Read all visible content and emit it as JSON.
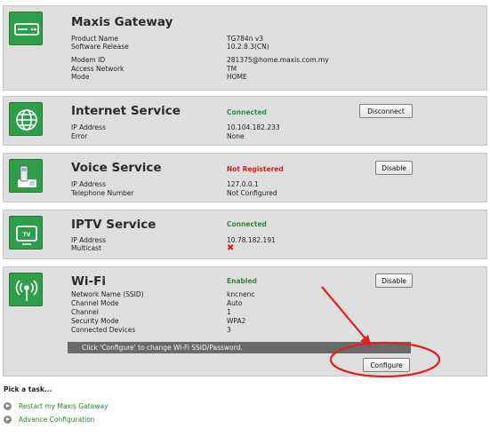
{
  "gateway": {
    "title": "Maxis Gateway",
    "rows": [
      {
        "label": "Product Name",
        "value": "TG784n v3"
      },
      {
        "label": "Software Release",
        "value": "10.2.8.3(CN)"
      },
      {
        "label": "Modem ID",
        "value": "281375@home.maxis.com.my"
      },
      {
        "label": "Access Network",
        "value": "TM"
      },
      {
        "label": "Mode",
        "value": "HOME"
      }
    ]
  },
  "internet": {
    "title": "Internet Service",
    "status": "Connected",
    "button": "Disconnect",
    "rows": [
      {
        "label": "IP Address",
        "value": "10.104.182.233"
      },
      {
        "label": "Error",
        "value": "None"
      }
    ]
  },
  "voice": {
    "title": "Voice Service",
    "status": "Not Registered",
    "button": "Disable",
    "rows": [
      {
        "label": "IP Address",
        "value": "127.0.0.1"
      },
      {
        "label": "Telephone Number",
        "value": "Not Configured"
      }
    ]
  },
  "iptv": {
    "title": "IPTV Service",
    "status": "Connected",
    "icon_text": "TV",
    "rows": [
      {
        "label": "IP Address",
        "value": "10.78.182.191"
      },
      {
        "label": "Multicast",
        "value": "✖"
      }
    ]
  },
  "wifi": {
    "title": "Wi-Fi",
    "status": "Enabled",
    "button": "Disable",
    "configure_button": "Configure",
    "info": "Click 'Configure' to change Wi-Fi SSID/Password.",
    "rows": [
      {
        "label": "Network Name (SSID)",
        "value": "kncnenc"
      },
      {
        "label": "Channel Mode",
        "value": "Auto"
      },
      {
        "label": "Channel",
        "value": "1"
      },
      {
        "label": "Security Mode",
        "value": "WPA2"
      },
      {
        "label": "Connected Devices",
        "value": "3"
      }
    ]
  },
  "tasks": {
    "title": "Pick a task...",
    "items": [
      "Restart my Maxis Gateway",
      "Advance Configuration"
    ]
  },
  "colors": {
    "icon_green": "#2e9e4a",
    "status_green": "#2e8b3e",
    "status_red": "#d11d1d",
    "annotation_red": "#e0201c"
  }
}
